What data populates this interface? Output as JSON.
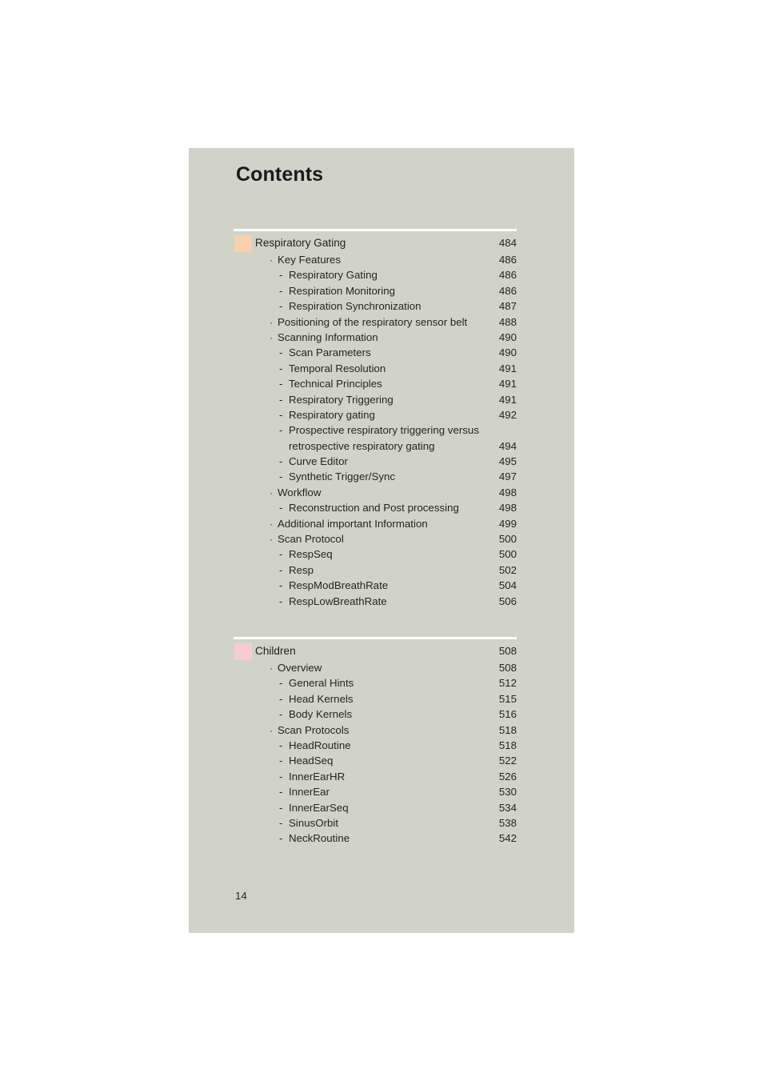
{
  "page": {
    "title": "Contents",
    "folio": "14",
    "background_color": "#d2d3c8",
    "rule_color": "#ffffff",
    "text_color": "#24241f"
  },
  "sections": [
    {
      "swatch_color": "#fad0ae",
      "heading": {
        "label": "Respiratory Gating",
        "page": "484"
      },
      "entries": [
        {
          "level": 2,
          "marker": "·",
          "label": "Key Features",
          "page": "486"
        },
        {
          "level": 3,
          "marker": "-",
          "label": "Respiratory Gating",
          "page": "486"
        },
        {
          "level": 3,
          "marker": "-",
          "label": "Respiration Monitoring",
          "page": "486"
        },
        {
          "level": 3,
          "marker": "-",
          "label": "Respiration Synchronization",
          "page": "487"
        },
        {
          "level": 2,
          "marker": "·",
          "label": "Positioning of the respiratory sensor belt",
          "page": "488"
        },
        {
          "level": 2,
          "marker": "·",
          "label": "Scanning Information",
          "page": "490"
        },
        {
          "level": 3,
          "marker": "-",
          "label": "Scan Parameters",
          "page": "490"
        },
        {
          "level": 3,
          "marker": "-",
          "label": "Temporal Resolution",
          "page": "491"
        },
        {
          "level": 3,
          "marker": "-",
          "label": "Technical Principles",
          "page": "491"
        },
        {
          "level": 3,
          "marker": "-",
          "label": "Respiratory Triggering",
          "page": "491"
        },
        {
          "level": 3,
          "marker": "-",
          "label": "Respiratory gating",
          "page": "492"
        },
        {
          "level": 3,
          "marker": "-",
          "label": "Prospective respiratory triggering versus",
          "page": ""
        },
        {
          "level": 0,
          "marker": "",
          "label": "retrospective respiratory gating",
          "page": "494"
        },
        {
          "level": 3,
          "marker": "-",
          "label": "Curve Editor",
          "page": "495"
        },
        {
          "level": 3,
          "marker": "-",
          "label": "Synthetic Trigger/Sync",
          "page": "497"
        },
        {
          "level": 2,
          "marker": "·",
          "label": "Workflow",
          "page": "498"
        },
        {
          "level": 3,
          "marker": "-",
          "label": "Reconstruction and Post processing",
          "page": "498"
        },
        {
          "level": 2,
          "marker": "·",
          "label": "Additional important Information",
          "page": "499"
        },
        {
          "level": 2,
          "marker": "·",
          "label": "Scan Protocol",
          "page": "500"
        },
        {
          "level": 3,
          "marker": "-",
          "label": "RespSeq",
          "page": "500"
        },
        {
          "level": 3,
          "marker": "-",
          "label": "Resp",
          "page": "502"
        },
        {
          "level": 3,
          "marker": "-",
          "label": "RespModBreathRate",
          "page": "504"
        },
        {
          "level": 3,
          "marker": "-",
          "label": "RespLowBreathRate",
          "page": "506"
        }
      ]
    },
    {
      "swatch_color": "#f8cdd0",
      "heading": {
        "label": "Children",
        "page": "508"
      },
      "entries": [
        {
          "level": 2,
          "marker": "·",
          "label": "Overview",
          "page": "508"
        },
        {
          "level": 3,
          "marker": "-",
          "label": "General Hints",
          "page": "512"
        },
        {
          "level": 3,
          "marker": "-",
          "label": "Head Kernels",
          "page": "515"
        },
        {
          "level": 3,
          "marker": "-",
          "label": "Body Kernels",
          "page": "516"
        },
        {
          "level": 2,
          "marker": "·",
          "label": "Scan Protocols",
          "page": "518"
        },
        {
          "level": 3,
          "marker": "-",
          "label": "HeadRoutine",
          "page": "518"
        },
        {
          "level": 3,
          "marker": "-",
          "label": "HeadSeq",
          "page": "522"
        },
        {
          "level": 3,
          "marker": "-",
          "label": "InnerEarHR",
          "page": "526"
        },
        {
          "level": 3,
          "marker": "-",
          "label": "InnerEar",
          "page": "530"
        },
        {
          "level": 3,
          "marker": "-",
          "label": "InnerEarSeq",
          "page": "534"
        },
        {
          "level": 3,
          "marker": "-",
          "label": "SinusOrbit",
          "page": "538"
        },
        {
          "level": 3,
          "marker": "-",
          "label": "NeckRoutine",
          "page": "542"
        }
      ]
    }
  ]
}
